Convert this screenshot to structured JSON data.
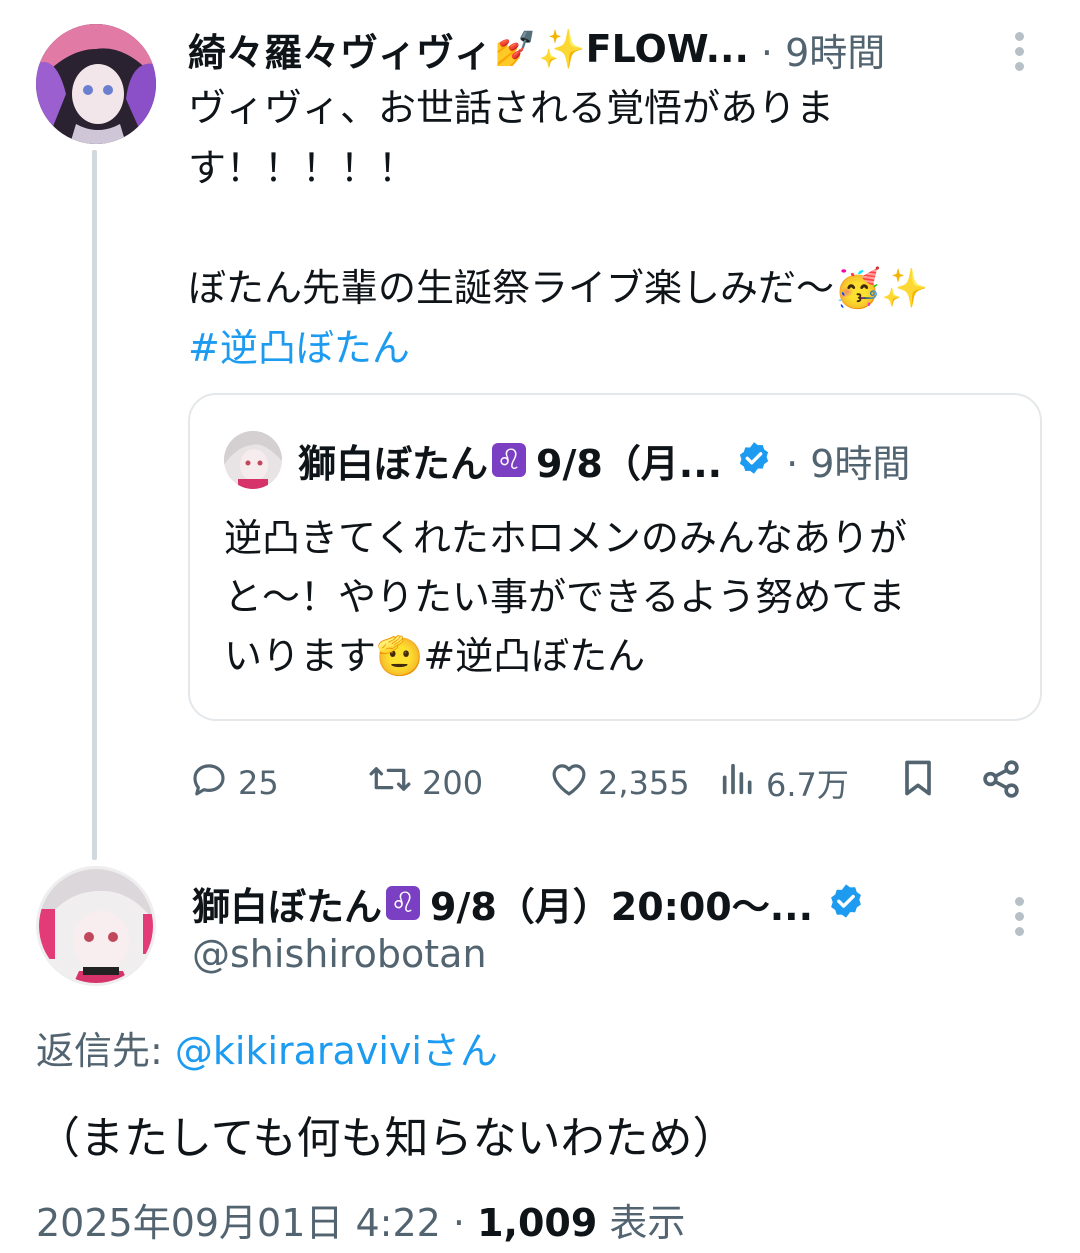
{
  "tweet": {
    "author_name": "綺々羅々ヴィヴィ",
    "author_name_suffix": "✨FLOW...",
    "time": "· 9時間",
    "text_line1": "ヴィヴィ、お世話される覚悟がありま",
    "text_line2": "す！！！！！",
    "text_line3": "ぼたん先輩の生誕祭ライブ楽しみだ〜",
    "text_emoji": "🥳✨",
    "hashtag": "#逆凸ぼたん"
  },
  "quote": {
    "author_name": "獅白ぼたん",
    "author_suffix": "9/8（月...",
    "leo_symbol": "♌",
    "time": "· 9時間",
    "text_line1": "逆凸きてくれたホロメンのみんなありが",
    "text_line2": "と〜！やりたい事ができるよう努めてま",
    "text_line3a": "いります",
    "text_emoji": "🫡",
    "text_hashtag": "#逆凸ぼたん"
  },
  "actions": {
    "replies": "25",
    "retweets": "200",
    "likes": "2,355",
    "views": "6.7万"
  },
  "reply": {
    "author_name": "獅白ぼたん",
    "leo_symbol": "♌",
    "author_suffix": "9/8（月）20:00〜...",
    "handle": "@shishirobotan",
    "reply_to_label": "返信先: ",
    "reply_to_user": "@kikiraraviviさん",
    "text": "（またしても何も知らないわため）",
    "timestamp": "2025年09月01日 4:22 · ",
    "view_count": "1,009",
    "view_label": " 表示"
  },
  "colors": {
    "accent": "#1d9bf0",
    "muted": "#536471",
    "border": "#e4e8eb"
  }
}
